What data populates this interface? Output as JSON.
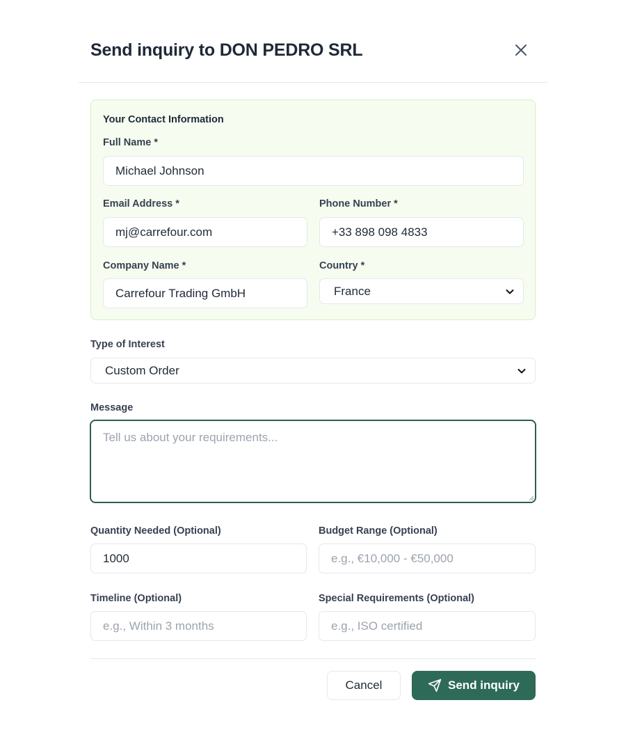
{
  "dialog": {
    "title": "Send inquiry to DON PEDRO SRL",
    "close_icon": "close-icon"
  },
  "contact": {
    "section_title": "Your Contact Information",
    "full_name": {
      "label": "Full Name *",
      "value": "Michael Johnson"
    },
    "email": {
      "label": "Email Address *",
      "value": "mj@carrefour.com"
    },
    "phone": {
      "label": "Phone Number *",
      "value": "+33 898 098 4833"
    },
    "company": {
      "label": "Company Name *",
      "value": "Carrefour Trading GmbH"
    },
    "country": {
      "label": "Country *",
      "value": "France"
    }
  },
  "interest": {
    "label": "Type of Interest",
    "value": "Custom Order"
  },
  "message": {
    "label": "Message",
    "value": "",
    "placeholder": "Tell us about your requirements..."
  },
  "quantity": {
    "label": "Quantity Needed (Optional)",
    "value": "1000",
    "placeholder": ""
  },
  "budget": {
    "label": "Budget Range (Optional)",
    "value": "",
    "placeholder": "e.g., €10,000 - €50,000"
  },
  "timeline": {
    "label": "Timeline (Optional)",
    "value": "",
    "placeholder": "e.g., Within 3 months"
  },
  "special": {
    "label": "Special Requirements (Optional)",
    "value": "",
    "placeholder": "e.g., ISO certified"
  },
  "actions": {
    "cancel_label": "Cancel",
    "send_label": "Send inquiry",
    "send_icon": "send-icon"
  },
  "colors": {
    "accent": "#2e6a58",
    "contact_bg": "#f6fdf0",
    "contact_border": "#d7efba"
  }
}
